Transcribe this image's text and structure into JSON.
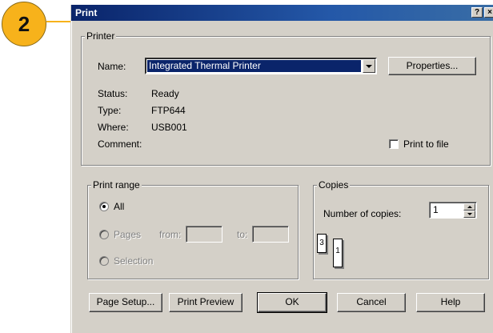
{
  "callout": {
    "number": "2"
  },
  "dialog": {
    "title": "Print",
    "help_button": "?",
    "close_button": "×"
  },
  "printer": {
    "group_label": "Printer",
    "name_label": "Name:",
    "name_value": "Integrated Thermal Printer",
    "properties_button": "Properties...",
    "status_label": "Status:",
    "status_value": "Ready",
    "type_label": "Type:",
    "type_value": "FTP644",
    "where_label": "Where:",
    "where_value": "USB001",
    "comment_label": "Comment:",
    "print_to_file_label": "Print to file",
    "print_to_file_checked": false
  },
  "print_range": {
    "group_label": "Print range",
    "all_label": "All",
    "pages_label": "Pages",
    "from_label": "from:",
    "to_label": "to:",
    "selection_label": "Selection",
    "selected": "all"
  },
  "copies": {
    "group_label": "Copies",
    "number_label": "Number of copies:",
    "number_value": "1",
    "collate_page_numbers": [
      "3",
      "1"
    ]
  },
  "buttons": {
    "page_setup": "Page Setup...",
    "print_preview": "Print Preview",
    "ok": "OK",
    "cancel": "Cancel",
    "help": "Help"
  }
}
